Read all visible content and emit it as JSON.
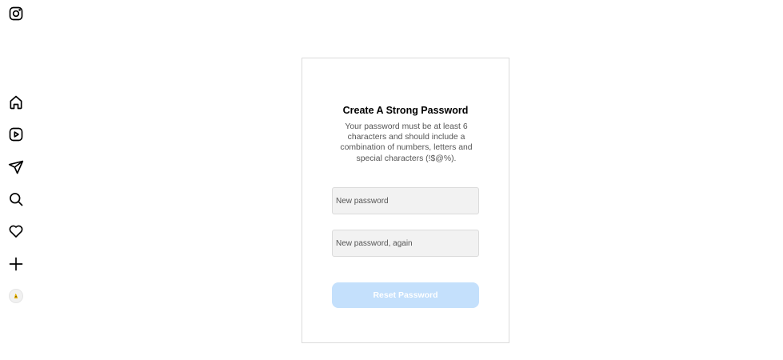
{
  "sidebar": {
    "icons": [
      "instagram-logo-icon",
      "home-icon",
      "reels-icon",
      "messages-icon",
      "search-icon",
      "notifications-icon",
      "create-icon",
      "profile-avatar"
    ]
  },
  "reset_card": {
    "title": "Create A Strong Password",
    "description": "Your password must be at least 6 characters and should include a combination of numbers, letters and special characters (!$@%).",
    "new_password": {
      "value": "",
      "placeholder": "New password"
    },
    "new_password_again": {
      "value": "",
      "placeholder": "New password, again"
    },
    "submit_label": "Reset Password"
  },
  "colors": {
    "button_disabled_bg": "#c4e0fc",
    "card_border": "#dbdbdb",
    "field_bg": "#f2f2f2"
  }
}
